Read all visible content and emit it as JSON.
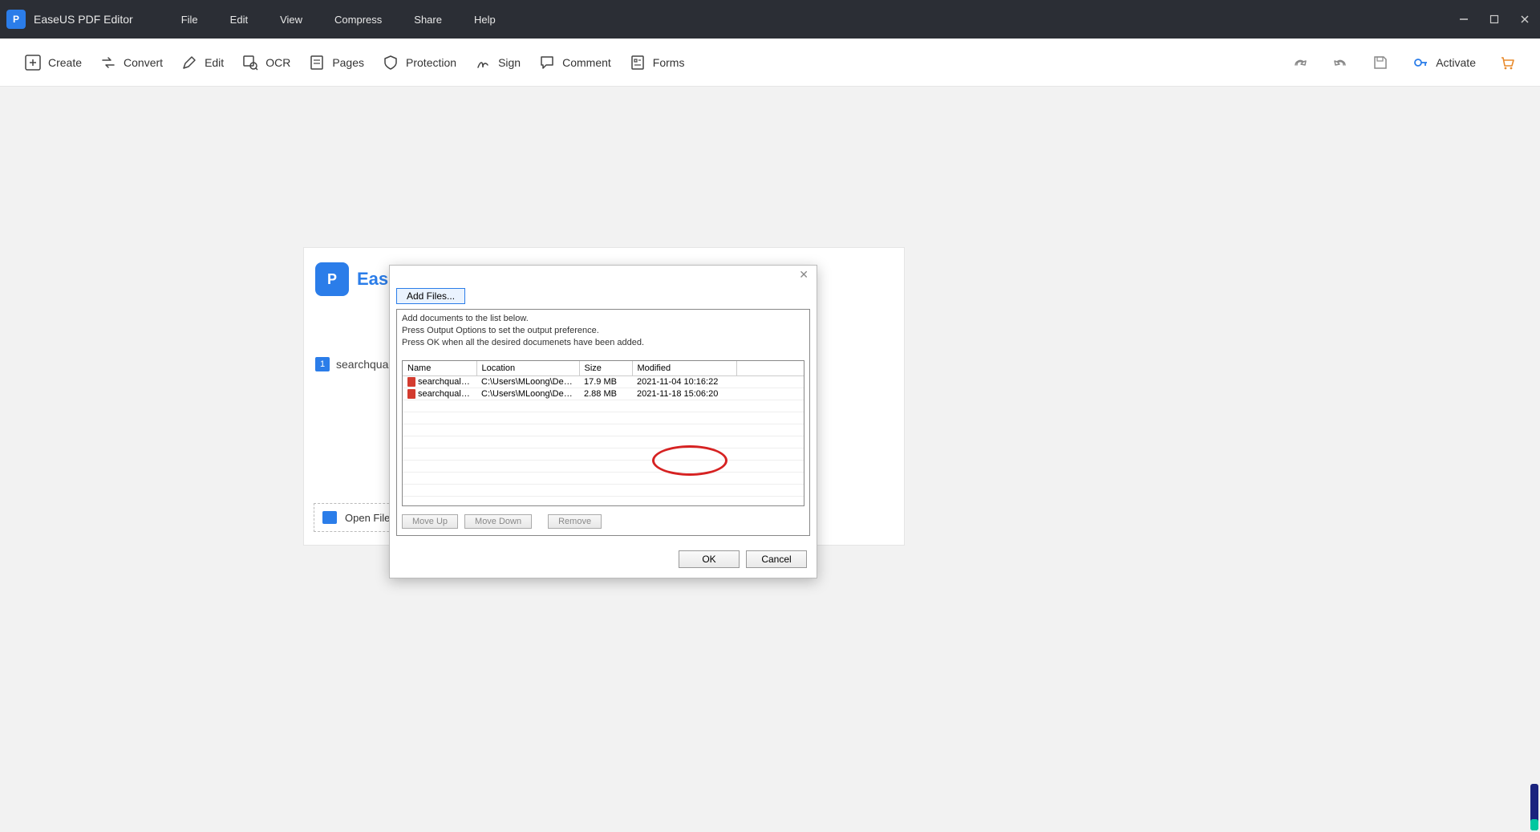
{
  "app": {
    "name": "EaseUS PDF Editor"
  },
  "menu": {
    "file": "File",
    "edit": "Edit",
    "view": "View",
    "compress": "Compress",
    "share": "Share",
    "help": "Help"
  },
  "toolbar": {
    "create": "Create",
    "convert": "Convert",
    "edit": "Edit",
    "ocr": "OCR",
    "pages": "Pages",
    "protection": "Protection",
    "sign": "Sign",
    "comment": "Comment",
    "forms": "Forms",
    "activate": "Activate"
  },
  "welcome": {
    "brand": "EaseU",
    "recent_file": "searchquality",
    "recent_badge": "1",
    "open_files": "Open Files..."
  },
  "dialog": {
    "add_files": "Add Files...",
    "instructions_l1": "Add documents to the list below.",
    "instructions_l2": "Press Output Options to set the output preference.",
    "instructions_l3": "Press OK when all the desired documenets have been added.",
    "columns": {
      "name": "Name",
      "location": "Location",
      "size": "Size",
      "modified": "Modified"
    },
    "rows": [
      {
        "name": "searchqualitye...",
        "location": "C:\\Users\\MLoong\\Desktop",
        "size": "17.9 MB",
        "modified": "2021-11-04 10:16:22"
      },
      {
        "name": "searchqualitye...",
        "location": "C:\\Users\\MLoong\\Desktop",
        "size": "2.88 MB",
        "modified": "2021-11-18 15:06:20"
      }
    ],
    "move_up": "Move Up",
    "move_down": "Move Down",
    "remove": "Remove",
    "ok": "OK",
    "cancel": "Cancel"
  }
}
